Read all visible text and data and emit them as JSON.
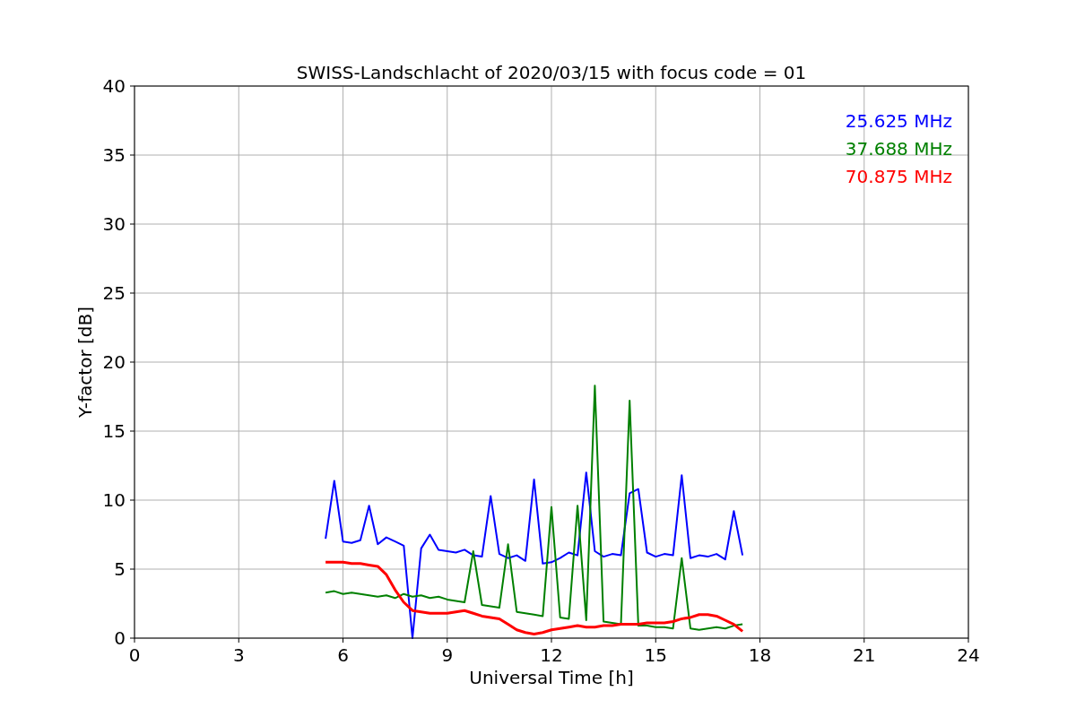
{
  "figure": {
    "chart_data": {
      "type": "line",
      "grid": true,
      "title": "SWISS-Landschlacht of 2020/03/15 with focus code = 01",
      "xlabel": "Universal Time [h]",
      "ylabel": "Y-factor [dB]",
      "xlim": [
        0,
        24
      ],
      "ylim": [
        0,
        40
      ],
      "xticks": [
        0,
        3,
        6,
        9,
        12,
        15,
        18,
        21,
        24
      ],
      "yticks": [
        0,
        5,
        10,
        15,
        20,
        25,
        30,
        35,
        40
      ],
      "x": [
        5.5,
        5.75,
        6,
        6.25,
        6.5,
        6.75,
        7,
        7.25,
        7.5,
        7.75,
        8,
        8.25,
        8.5,
        8.75,
        9,
        9.25,
        9.5,
        9.75,
        10,
        10.25,
        10.5,
        10.75,
        11,
        11.25,
        11.5,
        11.75,
        12,
        12.25,
        12.5,
        12.75,
        13,
        13.25,
        13.5,
        13.75,
        14,
        14.25,
        14.5,
        14.75,
        15,
        15.25,
        15.5,
        15.75,
        16,
        16.25,
        16.5,
        16.75,
        17,
        17.25,
        17.5
      ],
      "series": [
        {
          "name": "25.625 MHz",
          "color": "#0000ff",
          "values": [
            7.2,
            11.4,
            7.0,
            6.9,
            7.1,
            9.6,
            6.8,
            7.3,
            7.0,
            6.7,
            0,
            6.5,
            7.5,
            6.4,
            6.3,
            6.2,
            6.4,
            6.0,
            5.9,
            10.3,
            6.1,
            5.8,
            6.0,
            5.6,
            11.5,
            5.4,
            5.5,
            5.8,
            6.2,
            6.0,
            12.0,
            6.3,
            5.9,
            6.1,
            6.0,
            10.5,
            10.8,
            6.2,
            5.9,
            6.1,
            6.0,
            11.8,
            5.8,
            6.0,
            5.9,
            6.1,
            5.7,
            9.2,
            6.0
          ]
        },
        {
          "name": "37.688 MHz",
          "color": "#008000",
          "values": [
            3.3,
            3.4,
            3.2,
            3.3,
            3.2,
            3.1,
            3.0,
            3.1,
            2.9,
            3.2,
            3.0,
            3.1,
            2.9,
            3.0,
            2.8,
            2.7,
            2.6,
            6.3,
            2.4,
            2.3,
            2.2,
            6.8,
            1.9,
            1.8,
            1.7,
            1.6,
            9.5,
            1.5,
            1.4,
            9.6,
            1.3,
            18.3,
            1.2,
            1.1,
            1.0,
            17.2,
            0.9,
            0.9,
            0.8,
            0.8,
            0.7,
            5.8,
            0.7,
            0.6,
            0.7,
            0.8,
            0.7,
            0.9,
            1.0
          ]
        },
        {
          "name": "70.875 MHz",
          "color": "#ff0000",
          "values": [
            5.5,
            5.5,
            5.5,
            5.4,
            5.4,
            5.3,
            5.2,
            4.6,
            3.5,
            2.6,
            2.0,
            1.9,
            1.8,
            1.8,
            1.8,
            1.9,
            2.0,
            1.8,
            1.6,
            1.5,
            1.4,
            1.0,
            0.6,
            0.4,
            0.3,
            0.4,
            0.6,
            0.7,
            0.8,
            0.9,
            0.8,
            0.8,
            0.9,
            0.9,
            1.0,
            1.0,
            1.0,
            1.1,
            1.1,
            1.1,
            1.2,
            1.4,
            1.5,
            1.7,
            1.7,
            1.6,
            1.3,
            1.0,
            0.5
          ]
        }
      ]
    }
  }
}
